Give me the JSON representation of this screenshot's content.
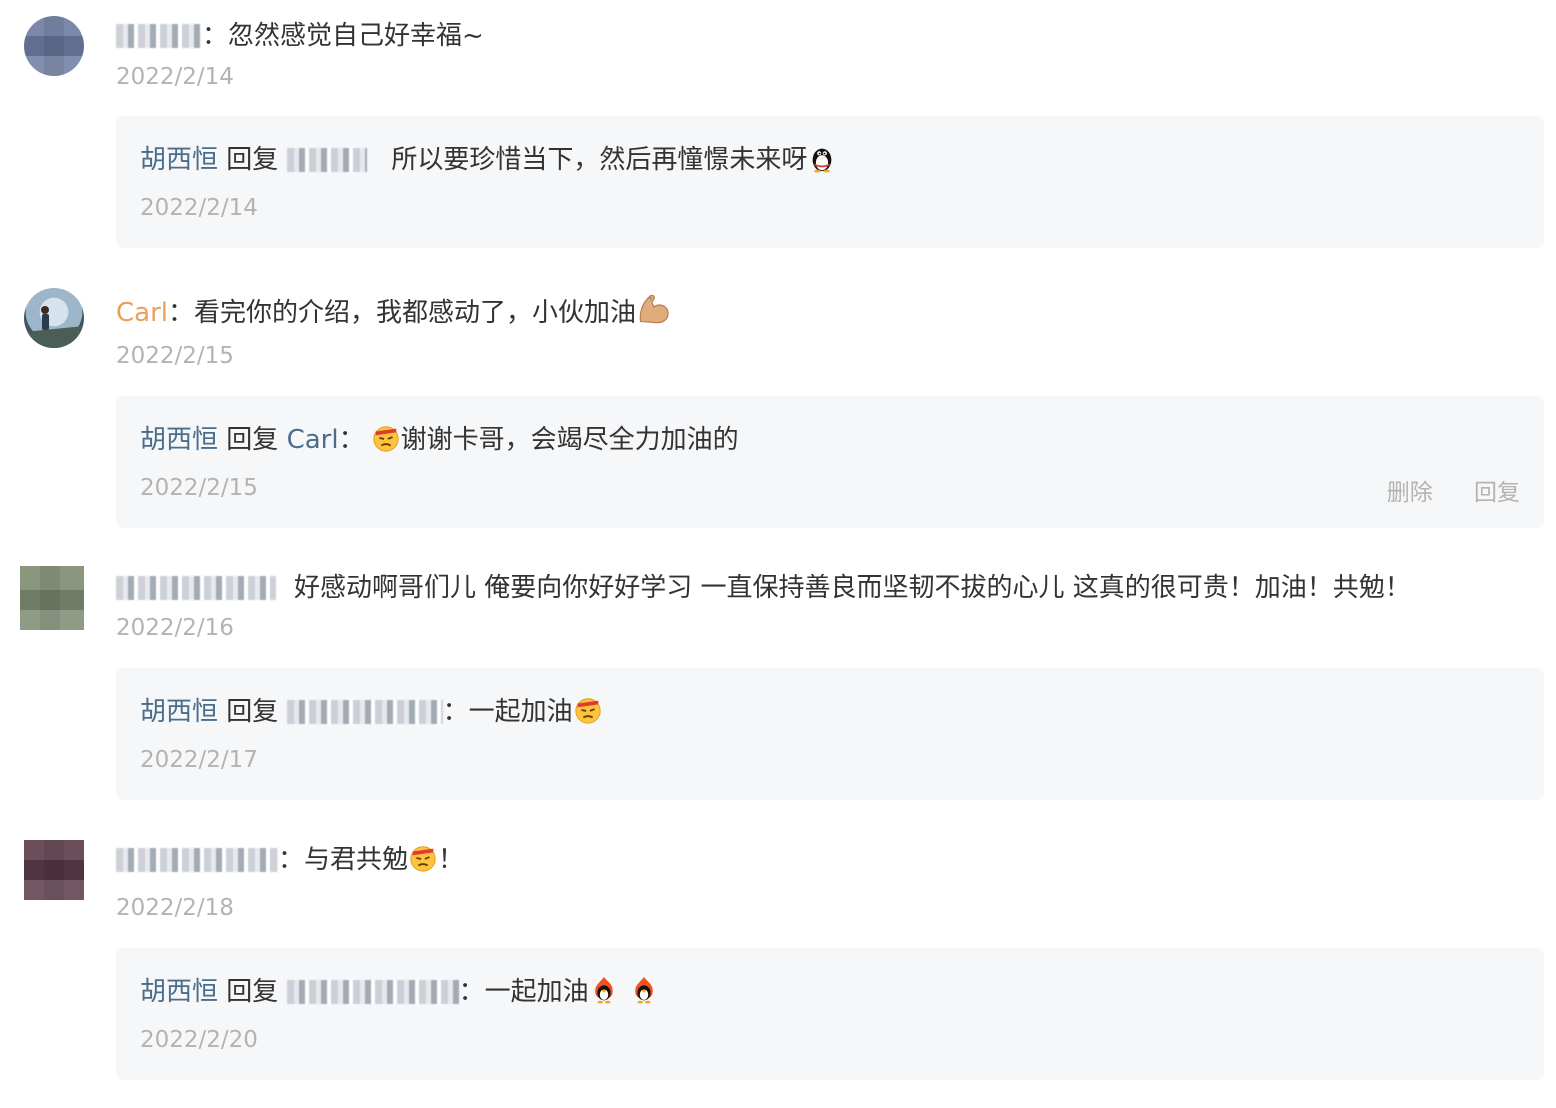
{
  "comments": [
    {
      "author": "",
      "text": "忽然感觉自己好幸福~",
      "date": "2022/2/14",
      "reply": {
        "replier": "胡西恒",
        "reply_word": "回复",
        "target": "",
        "text": "所以要珍惜当下，然后再憧憬未来呀",
        "emoji": "penguin-emoji",
        "date": "2022/2/14"
      }
    },
    {
      "author": "Carl",
      "text": "看完你的介绍，我都感动了，小伙加油",
      "emoji": "flexed-biceps-emoji",
      "date": "2022/2/15",
      "reply": {
        "replier": "胡西恒",
        "reply_word": "回复",
        "target": "Carl",
        "text": "谢谢卡哥，会竭尽全力加油的",
        "emoji": "determined-face-emoji",
        "date": "2022/2/15",
        "actions": {
          "delete": "删除",
          "reply": "回复"
        }
      }
    },
    {
      "author": "",
      "text": "好感动啊哥们儿 俺要向你好好学习 一直保持善良而坚韧不拔的心儿 这真的很可贵！加油！共勉！",
      "date": "2022/2/16",
      "reply": {
        "replier": "胡西恒",
        "reply_word": "回复",
        "target": "",
        "text": "一起加油",
        "emoji": "determined-face-emoji",
        "date": "2022/2/17"
      }
    },
    {
      "author": "",
      "text": "与君共勉",
      "text_after": "！",
      "emoji": "determined-face-emoji",
      "date": "2022/2/18",
      "reply": {
        "replier": "胡西恒",
        "reply_word": "回复",
        "target": "",
        "text": "一起加油",
        "emoji": "fire-penguin-emoji",
        "date": "2022/2/20"
      }
    }
  ],
  "colon": "：",
  "colors": {
    "reply_name": "#4a6d8c",
    "author_orange": "#e8a05a",
    "date_gray": "#b3b3b3",
    "reply_bg": "#f6f7f9"
  }
}
